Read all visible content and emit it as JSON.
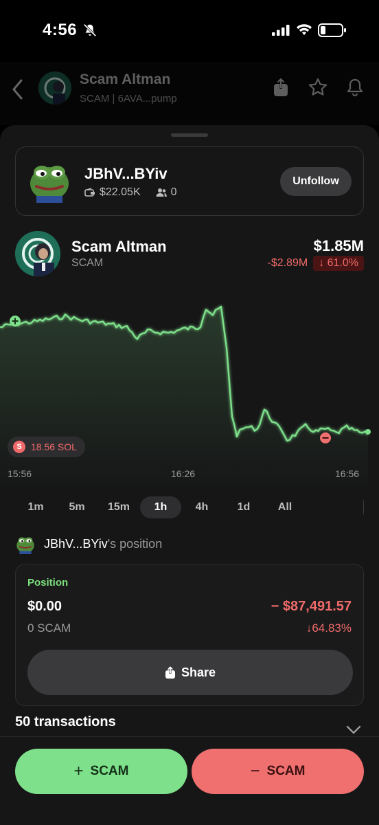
{
  "status_bar": {
    "time": "4:56"
  },
  "background_header": {
    "title": "Scam Altman",
    "subtitle": "SCAM | 6AVA...pump"
  },
  "trader": {
    "name": "JBhV...BYiv",
    "balance": "$22.05K",
    "followers": "0",
    "follow_button": "Unfollow"
  },
  "token": {
    "name": "Scam Altman",
    "symbol": "SCAM",
    "market_cap": "$1.85M",
    "change_abs": "-$2.89M",
    "change_pct": "↓ 61.0%",
    "change_color": "#ef6a6a"
  },
  "chart": {
    "sell_badge": "18.56 SOL",
    "sell_badge_icon": "S",
    "time_labels": [
      "15:56",
      "16:26",
      "16:56"
    ],
    "line_color": "#7ee08a"
  },
  "range_tabs": {
    "items": [
      "1m",
      "5m",
      "15m",
      "1h",
      "4h",
      "1d",
      "All"
    ],
    "active": "1h"
  },
  "position": {
    "owner": "JBhV...BYiv",
    "owner_suffix": "'s position",
    "label": "Position",
    "value": "$0.00",
    "pnl": "− $87,491.57",
    "amount": "0 SCAM",
    "pnl_pct": "↓64.83%",
    "share_label": "Share"
  },
  "transactions": {
    "label": "50 transactions"
  },
  "actions": {
    "buy_label": "SCAM",
    "sell_label": "SCAM",
    "buy_color": "#7ee08a",
    "sell_color": "#f07070"
  }
}
